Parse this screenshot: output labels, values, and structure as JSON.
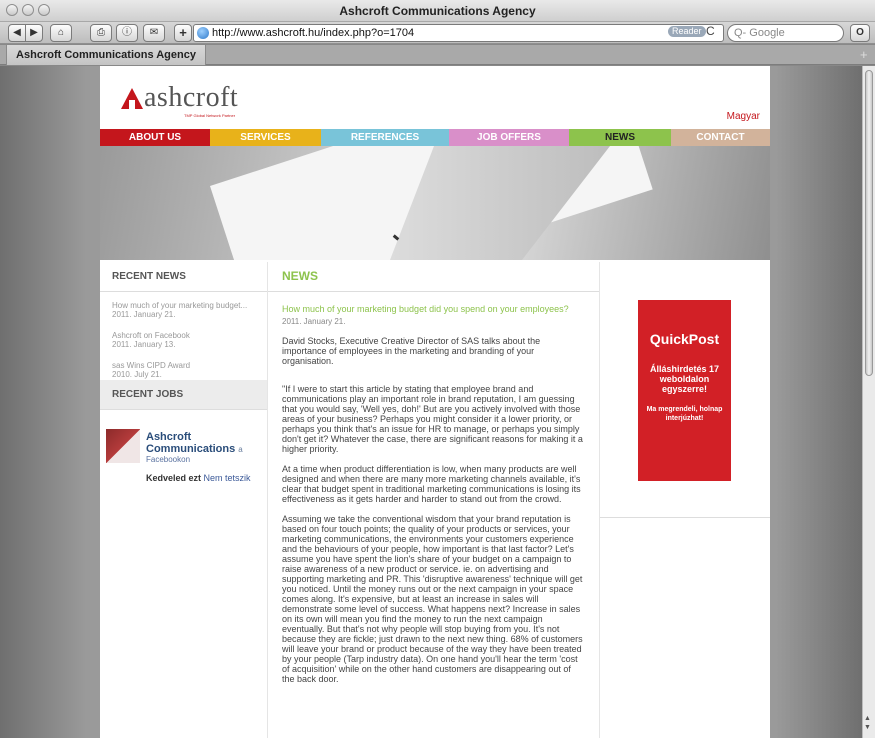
{
  "window": {
    "title": "Ashcroft Communications Agency"
  },
  "toolbar": {
    "back_label": "◀",
    "forward_label": "▶",
    "home_label": "⌂",
    "print_label": "⎙",
    "info_label": "ⓘ",
    "bookmark_label": "✉",
    "add_label": "+",
    "url": "http://www.ashcroft.hu/index.php?o=1704",
    "reader_label": "Reader",
    "reload_label": "C",
    "search_placeholder": "Q- Google",
    "extension_label": "O"
  },
  "tabs": [
    {
      "label": "Ashcroft Communications Agency"
    }
  ],
  "tab_add_label": "+",
  "site": {
    "logo_text": "ashcroft",
    "logo_tagline": "TMP Global Network Partner",
    "language_link": "Magyar",
    "nav": [
      {
        "label": "ABOUT US",
        "color": "#c4161c"
      },
      {
        "label": "SERVICES",
        "color": "#e8b21a"
      },
      {
        "label": "REFERENCES",
        "color": "#79c4d9"
      },
      {
        "label": "JOB OFFERS",
        "color": "#d98fc9"
      },
      {
        "label": "NEWS",
        "color": "#8dc34c"
      },
      {
        "label": "CONTACT",
        "color": "#d2b39b"
      }
    ]
  },
  "sidebar": {
    "recent_news_title": "RECENT NEWS",
    "news": [
      {
        "title": "How much of your marketing budget...",
        "date": "2011. January 21."
      },
      {
        "title": "Ashcroft on Facebook",
        "date": "2011. January 13."
      },
      {
        "title": "sas Wins CIPD Award",
        "date": "2010. July 21."
      }
    ],
    "recent_jobs_title": "RECENT JOBS",
    "facebook": {
      "name": "Ashcroft Communications",
      "connector": "a",
      "sub": "Facebookon",
      "like_prompt": "Kedveled ezt",
      "unlike_link": "Nem tetszik"
    }
  },
  "main": {
    "section_title": "NEWS",
    "article": {
      "title": "How much of your marketing budget did you spend on your employees?",
      "date": "2011. January 21.",
      "intro": "David Stocks, Executive Creative Director of SAS talks about the importance of employees in the marketing and branding of your organisation.",
      "paragraphs": [
        "\"If I were to start this article by stating that employee brand and communications play an important role in brand reputation, I am guessing that you would say, 'Well yes, doh!' But are you actively involved with those areas of your business? Perhaps you might consider it a lower priority, or perhaps you think that's an issue for HR to manage, or perhaps you simply don't get it? Whatever the case, there are significant reasons for making it a higher priority.",
        "At a time when product differentiation is low, when many products are well designed and when there are many more marketing channels available, it's clear that budget spent in traditional marketing communications is losing its effectiveness as it gets harder and harder to stand out from the crowd.",
        "Assuming we take the conventional wisdom that your brand reputation is based on four touch points; the quality of your products or services, your marketing communications, the environments your customers experience and the behaviours of your people, how important is that last factor? Let's assume you have spent the lion's share of your budget on a campaign to raise awareness of a new product or service. ie. on advertising and supporting marketing and PR. This 'disruptive awareness' technique will get you noticed. Until the money runs out or the next campaign in your space comes along. It's expensive, but at least an increase in sales will demonstrate some level of success. What happens next? Increase in sales on its own will mean you find the money to run the next campaign eventually. But that's not why people will stop buying from you. It's not because they are fickle; just drawn to the next new thing. 68% of customers will leave your brand or product because of the way they have been treated by your people (Tarp industry data). On one hand you'll hear the term 'cost of acquisition' while on the other hand customers are disappearing out of the back door."
      ]
    }
  },
  "ad": {
    "brand": "QuickPost",
    "line1": "Álláshirdetés 17 weboldalon egyszerre!",
    "line2": "Ma megrendeli, holnap interjúzhat!"
  }
}
